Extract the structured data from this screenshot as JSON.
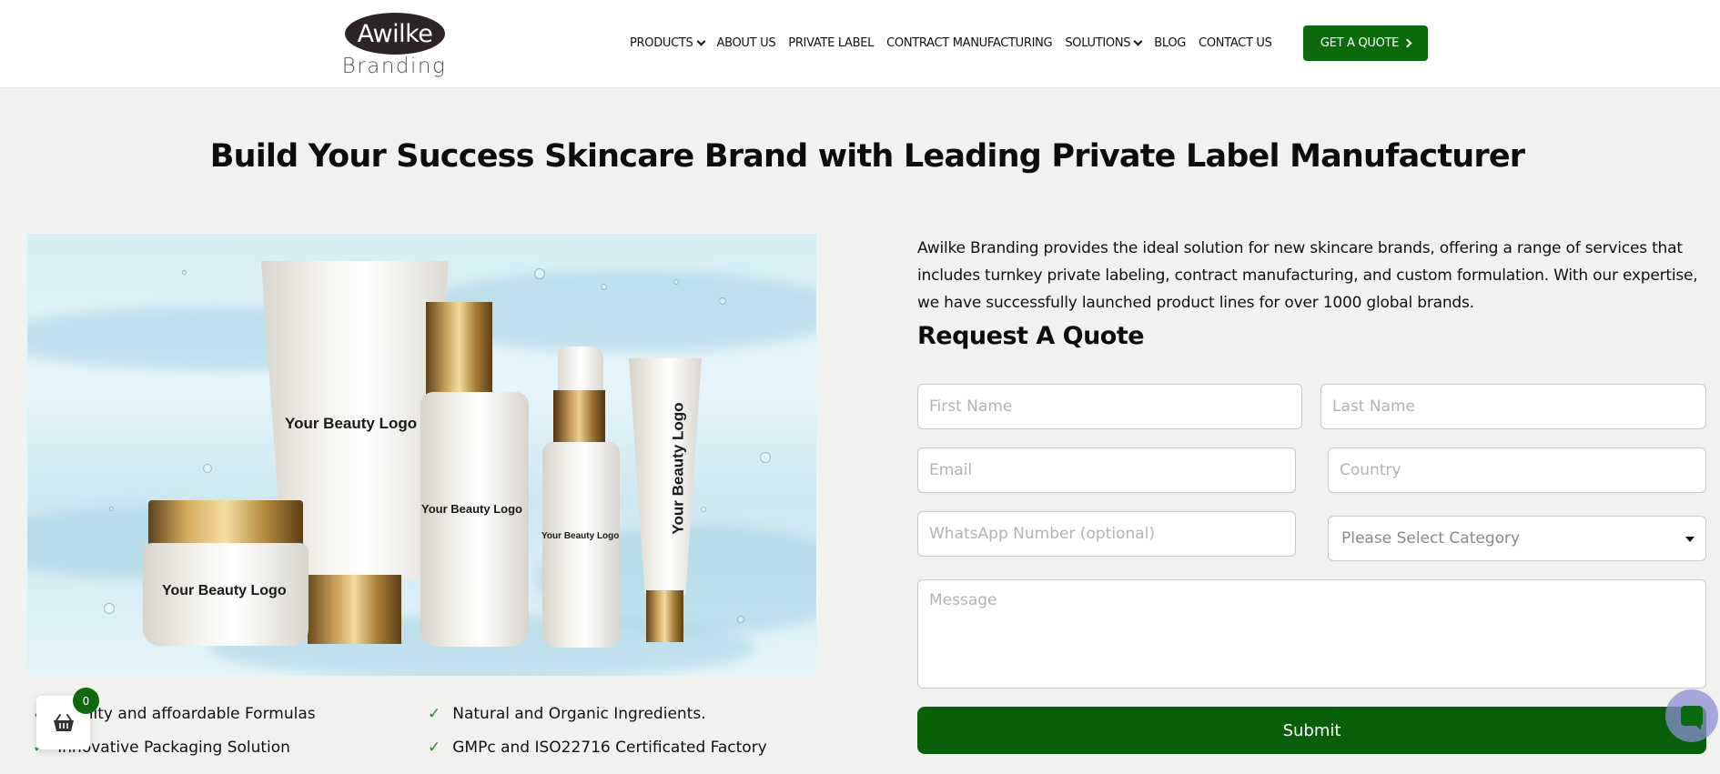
{
  "brand": {
    "logo_main": "Awilke",
    "logo_sub": "Branding"
  },
  "nav": {
    "items": [
      {
        "label": "PRODUCTS",
        "has_dropdown": true
      },
      {
        "label": "ABOUT US",
        "has_dropdown": false
      },
      {
        "label": "PRIVATE LABEL",
        "has_dropdown": false
      },
      {
        "label": "CONTRACT MANUFACTURING",
        "has_dropdown": false
      },
      {
        "label": "SOLUTIONS",
        "has_dropdown": true
      },
      {
        "label": "BLOG",
        "has_dropdown": false
      },
      {
        "label": "CONTACT US",
        "has_dropdown": false
      }
    ],
    "cta_label": "GET A QUOTE"
  },
  "hero": {
    "title": "Build Your Success Skincare Brand with Leading Private Label Manufacturer"
  },
  "product_image": {
    "label_text": "Your Beauty Logo"
  },
  "features": [
    "Quality and affoardable Formulas",
    "Natural and Organic Ingredients.",
    "Innovative Packaging Solution",
    "GMPc and ISO22716 Certificated Factory"
  ],
  "cart": {
    "count": "0"
  },
  "intro": {
    "text": "Awilke Branding provides the ideal solution for new skincare brands, offering a range of services that includes turnkey private labeling, contract manufacturing, and custom formulation. With our expertise, we have successfully launched product lines for over 1000 global brands."
  },
  "form": {
    "title": "Request A Quote",
    "first_name_placeholder": "First Name",
    "last_name_placeholder": "Last Name",
    "email_placeholder": "Email",
    "country_placeholder": "Country",
    "whatsapp_placeholder": "WhatsApp Number (optional)",
    "category_selected": "Please Select Category",
    "message_placeholder": "Message",
    "submit_label": "Submit"
  },
  "colors": {
    "brand_green": "#0b6a0b",
    "page_bg": "#f1f1ef",
    "chat_bubble": "#8c8cd7"
  },
  "icons": {
    "cart": "basket-icon",
    "chat": "chat-icon",
    "check": "check-icon",
    "nav_dropdown": "chevron-down-icon",
    "cta_arrow": "chevron-right-icon"
  }
}
